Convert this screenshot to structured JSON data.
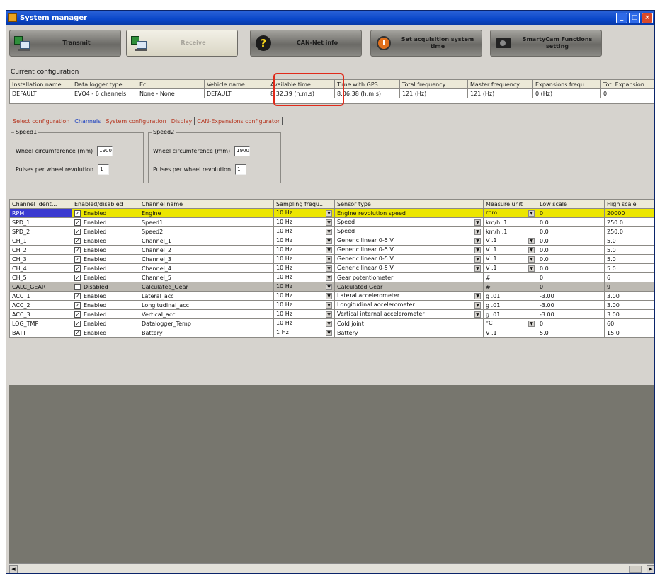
{
  "window": {
    "title": "System manager"
  },
  "toolbar": [
    {
      "label": "Transmit",
      "icon": "transmit-icon",
      "style": "dark"
    },
    {
      "label": "Receive",
      "icon": "receive-icon",
      "style": "light"
    },
    {
      "label": "CAN-Net info",
      "icon": "help-icon",
      "style": "dark"
    },
    {
      "label": "Set acquisition system time",
      "icon": "clock-icon",
      "style": "dark"
    },
    {
      "label": "SmartyCam Functions setting",
      "icon": "camera-icon",
      "style": "dark"
    }
  ],
  "current_configuration": {
    "label": "Current configuration",
    "headers": [
      "Installation name",
      "Data logger type",
      "Ecu",
      "Vehicle name",
      "Available time",
      "Time with GPS",
      "Total frequency",
      "Master frequency",
      "Expansions frequ...",
      "Tot. Expansion"
    ],
    "row": [
      "DEFAULT",
      "EVO4 - 6 channels",
      "None - None",
      "DEFAULT",
      "8:32:39 (h:m:s)",
      "8:06:38 (h:m:s)",
      "121 (Hz)",
      "121 (Hz)",
      "0 (Hz)",
      "0"
    ]
  },
  "tabs": [
    "Select configuration",
    "Channels",
    "System configuration",
    "Display",
    "CAN-Expansions configurator"
  ],
  "active_tab": "Channels",
  "speed1": {
    "title": "Speed1",
    "circ_label": "Wheel circumference    (mm)",
    "circ_value": "1900",
    "pulses_label": "Pulses per wheel revolution",
    "pulses_value": "1"
  },
  "speed2": {
    "title": "Speed2",
    "circ_label": "Wheel circumference    (mm)",
    "circ_value": "1900",
    "pulses_label": "Pulses per wheel revolution",
    "pulses_value": "1"
  },
  "channels": {
    "headers": [
      "Channel ident...",
      "Enabled/disabled",
      "Channel name",
      "Sampling frequ...",
      "Sensor type",
      "Measure unit",
      "Low scale",
      "High scale"
    ],
    "rows": [
      {
        "id": "RPM",
        "enabled": "Enabled",
        "name": "Engine",
        "freq": "10 Hz",
        "sensor": "Engine revolution speed",
        "unit": "rpm",
        "low": "0",
        "high": "20000",
        "style": "yellow",
        "checked": true,
        "sensor_dd": false,
        "unit_dd": true
      },
      {
        "id": "SPD_1",
        "enabled": "Enabled",
        "name": "Speed1",
        "freq": "10 Hz",
        "sensor": "Speed",
        "unit": "km/h .1",
        "low": "0.0",
        "high": "250.0",
        "style": "",
        "checked": true,
        "sensor_dd": true,
        "unit_dd": false
      },
      {
        "id": "SPD_2",
        "enabled": "Enabled",
        "name": "Speed2",
        "freq": "10 Hz",
        "sensor": "Speed",
        "unit": "km/h .1",
        "low": "0.0",
        "high": "250.0",
        "style": "",
        "checked": true,
        "sensor_dd": true,
        "unit_dd": false
      },
      {
        "id": "CH_1",
        "enabled": "Enabled",
        "name": "Channel_1",
        "freq": "10 Hz",
        "sensor": "Generic linear 0-5 V",
        "unit": "V .1",
        "low": "0.0",
        "high": "5.0",
        "style": "",
        "checked": true,
        "sensor_dd": true,
        "unit_dd": true
      },
      {
        "id": "CH_2",
        "enabled": "Enabled",
        "name": "Channel_2",
        "freq": "10 Hz",
        "sensor": "Generic linear 0-5 V",
        "unit": "V .1",
        "low": "0.0",
        "high": "5.0",
        "style": "",
        "checked": true,
        "sensor_dd": true,
        "unit_dd": true
      },
      {
        "id": "CH_3",
        "enabled": "Enabled",
        "name": "Channel_3",
        "freq": "10 Hz",
        "sensor": "Generic linear 0-5 V",
        "unit": "V .1",
        "low": "0.0",
        "high": "5.0",
        "style": "",
        "checked": true,
        "sensor_dd": true,
        "unit_dd": true
      },
      {
        "id": "CH_4",
        "enabled": "Enabled",
        "name": "Channel_4",
        "freq": "10 Hz",
        "sensor": "Generic linear 0-5 V",
        "unit": "V .1",
        "low": "0.0",
        "high": "5.0",
        "style": "",
        "checked": true,
        "sensor_dd": true,
        "unit_dd": true
      },
      {
        "id": "CH_5",
        "enabled": "Enabled",
        "name": "Channel_5",
        "freq": "10 Hz",
        "sensor": "Gear potentiometer",
        "unit": "#",
        "low": "0",
        "high": "6",
        "style": "",
        "checked": true,
        "sensor_dd": false,
        "unit_dd": false
      },
      {
        "id": "CALC_GEAR",
        "enabled": "Disabled",
        "name": "Calculated_Gear",
        "freq": "10 Hz",
        "sensor": "Calculated Gear",
        "unit": "#",
        "low": "0",
        "high": "9",
        "style": "gray",
        "checked": false,
        "sensor_dd": false,
        "unit_dd": false
      },
      {
        "id": "ACC_1",
        "enabled": "Enabled",
        "name": "Lateral_acc",
        "freq": "10 Hz",
        "sensor": "Lateral accelerometer",
        "unit": "g .01",
        "low": "-3.00",
        "high": "3.00",
        "style": "",
        "checked": true,
        "sensor_dd": true,
        "unit_dd": false
      },
      {
        "id": "ACC_2",
        "enabled": "Enabled",
        "name": "Longitudinal_acc",
        "freq": "10 Hz",
        "sensor": "Longitudinal accelerometer",
        "unit": "g .01",
        "low": "-3.00",
        "high": "3.00",
        "style": "",
        "checked": true,
        "sensor_dd": true,
        "unit_dd": false
      },
      {
        "id": "ACC_3",
        "enabled": "Enabled",
        "name": "Vertical_acc",
        "freq": "10 Hz",
        "sensor": "Vertical internal accelerometer",
        "unit": "g .01",
        "low": "-3.00",
        "high": "3.00",
        "style": "",
        "checked": true,
        "sensor_dd": true,
        "unit_dd": false
      },
      {
        "id": "LOG_TMP",
        "enabled": "Enabled",
        "name": "Datalogger_Temp",
        "freq": "10 Hz",
        "sensor": "Cold joint",
        "unit": "°C",
        "low": "0",
        "high": "60",
        "style": "",
        "checked": true,
        "sensor_dd": false,
        "unit_dd": true
      },
      {
        "id": "BATT",
        "enabled": "Enabled",
        "name": "Battery",
        "freq": "1 Hz",
        "sensor": "Battery",
        "unit": "V .1",
        "low": "5.0",
        "high": "15.0",
        "style": "",
        "checked": true,
        "sensor_dd": false,
        "unit_dd": false
      }
    ]
  },
  "colors": {
    "titlebar": "#0a47c9",
    "highlight_row": "#ece600",
    "highlight_box": "#e02a1a",
    "panel": "#d6d3ce"
  }
}
